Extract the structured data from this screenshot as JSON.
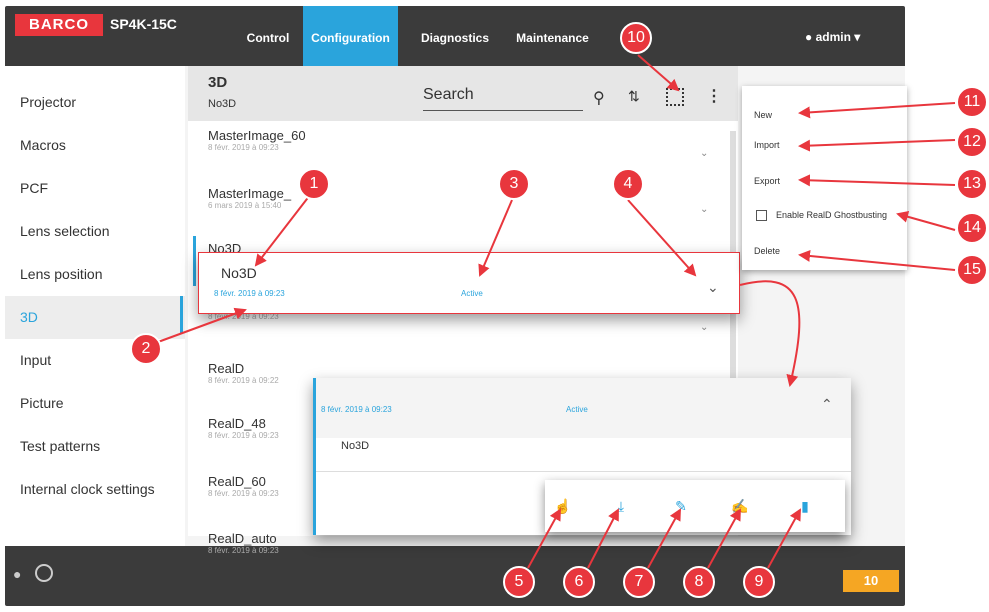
{
  "topbar": {
    "logo": "BARCO",
    "model": "SP4K-15C",
    "nav": [
      "Control",
      "Configuration",
      "Diagnostics",
      "Maintenance"
    ],
    "user": "admin"
  },
  "sidebar": {
    "items": [
      "Projector",
      "Macros",
      "PCF",
      "Lens selection",
      "Lens position",
      "3D",
      "Input",
      "Picture",
      "Test patterns",
      "Internal clock settings"
    ]
  },
  "panel": {
    "title": "3D",
    "subtitle": "No3D",
    "search_placeholder": "Search"
  },
  "list": {
    "items": [
      {
        "name": "MasterImage_60",
        "date": "8 févr. 2019 à 09:23"
      },
      {
        "name": "MasterImage_",
        "date": "6 mars 2019 à 15:40"
      },
      {
        "name": "No3D",
        "date": ""
      },
      {
        "name": "",
        "date": "8 févr. 2019 à 09:23"
      },
      {
        "name": "RealD",
        "date": "8 févr. 2019 à 09:22"
      },
      {
        "name": "RealD_48",
        "date": "8 févr. 2019 à 09:23"
      },
      {
        "name": "RealD_60",
        "date": "8 févr. 2019 à 09:23"
      },
      {
        "name": "RealD_auto",
        "date": "8 févr. 2019 à 09:23"
      }
    ]
  },
  "popup": {
    "name": "No3D",
    "date": "8 févr. 2019 à 09:23",
    "status": "Active"
  },
  "expanded": {
    "date": "8 févr. 2019 à 09:23",
    "status": "Active",
    "name": "No3D"
  },
  "menu": {
    "new": "New",
    "import": "Import",
    "export": "Export",
    "ghostbusting": "Enable RealD Ghostbusting",
    "delete": "Delete"
  },
  "bottombar": {
    "counter": "10"
  },
  "callouts": [
    "1",
    "2",
    "3",
    "4",
    "5",
    "6",
    "7",
    "8",
    "9",
    "10",
    "11",
    "12",
    "13",
    "14",
    "15"
  ],
  "colors": {
    "accent": "#2aa4dc",
    "callout": "#e8363d",
    "topbar": "#3b3b3b",
    "counter": "#f5a623"
  }
}
